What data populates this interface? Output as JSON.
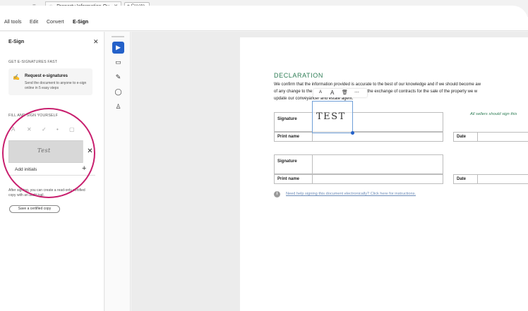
{
  "tabstrip": {
    "nav_controls": [
      "←",
      "≡"
    ],
    "file_tab": {
      "icon": "star-icon",
      "label": "Property Information Qu...",
      "close": "✕"
    },
    "create_tab": {
      "label": "+ Create"
    }
  },
  "menubar": {
    "items": [
      "All tools",
      "Edit",
      "Convert",
      "E-Sign"
    ],
    "active": "E-Sign"
  },
  "left_panel": {
    "title": "E-Sign",
    "close": "✕",
    "get_section": "GET E-SIGNATURES FAST",
    "request": {
      "title": "Request e-signatures",
      "description": "Send the document to anyone to e-sign online in 5 easy steps"
    },
    "fill_section": "FILL AND SIGN YOURSELF",
    "tools": [
      "text-tool-icon",
      "cross-icon",
      "check-icon",
      "dot-icon",
      "rectangle-icon"
    ],
    "signature_preview": "Test",
    "remove_signature": "✕",
    "add_initials": "Add initials",
    "add_initials_plus": "+",
    "certified_text": "After signing, you can create a read-only certified copy with an audit trail.",
    "certified_button": "Save a certified copy",
    "highlight_color": "#c81f6e"
  },
  "tool_rail": {
    "buttons": [
      {
        "name": "select-tool",
        "icon": "▶"
      },
      {
        "name": "comment-tool",
        "icon": "▭"
      },
      {
        "name": "draw-tool",
        "icon": "✎"
      },
      {
        "name": "lasso-tool",
        "icon": "◯"
      },
      {
        "name": "stamp-tool",
        "icon": "♙"
      }
    ]
  },
  "document": {
    "heading": "DECLARATION",
    "paragraph": [
      "We confirm that the information provided is accurate to the best of our knowledge and if we should become aw",
      "of any change to the information provided prior to the exchange of contracts for the sale of the property we w",
      "update our conveyancer and estate agent."
    ],
    "floating_toolbar": [
      "A",
      "A",
      "🗑",
      "⋯"
    ],
    "table1": {
      "signature_label": "Signature",
      "print_name_label": "Print name",
      "date_label": "Date"
    },
    "table2": {
      "signature_label": "Signature",
      "print_name_label": "Print name",
      "date_label": "Date"
    },
    "signature_text": "TEST",
    "all_sellers_note": "All sellers should sign this",
    "help_icon": "i",
    "help_link": "Need help signing this document electronically? Click here for instructions.",
    "accent_color": "#2e7d55",
    "selection_color": "#2461c9"
  }
}
